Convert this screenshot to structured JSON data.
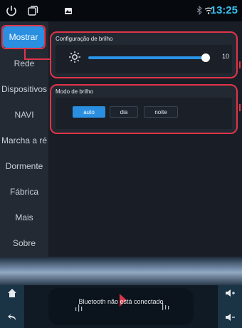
{
  "status_bar": {
    "icons": [
      "power-icon",
      "windows-icon",
      "image-icon",
      "bluetooth-icon",
      "wifi-icon"
    ],
    "time": "13:25",
    "time_color": "#39c3f0"
  },
  "sidebar": {
    "items": [
      {
        "label": "Mostrar",
        "active": true
      },
      {
        "label": "Rede"
      },
      {
        "label": "Dispositivos"
      },
      {
        "label": "NAVI"
      },
      {
        "label": "Marcha a ré"
      },
      {
        "label": "Dormente"
      },
      {
        "label": "Fábrica"
      },
      {
        "label": "Mais"
      },
      {
        "label": "Sobre"
      }
    ],
    "active_color": "#2a8fe0"
  },
  "brightness": {
    "title": "Configuração de brilho",
    "value": "10",
    "level": 0.96
  },
  "mode": {
    "title": "Modo de brilho",
    "options": [
      "auto",
      "dia",
      "noite"
    ],
    "selected": "auto"
  },
  "bottom": {
    "bt_status": "Bluetooth não está conectado",
    "icons": [
      "home-icon",
      "back-icon",
      "volume-up-icon",
      "volume-down-icon",
      "equalizer-icon"
    ]
  },
  "colors": {
    "highlight": "#e03448",
    "accent": "#2a93e6"
  }
}
